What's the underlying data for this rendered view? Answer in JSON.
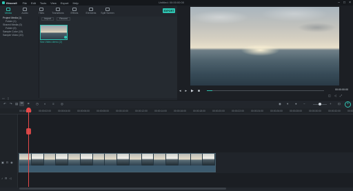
{
  "app": {
    "name": "filmora9",
    "doc_title": "Untitled: 00:00:00:00"
  },
  "menu": [
    "File",
    "Edit",
    "Tools",
    "View",
    "Export",
    "Help"
  ],
  "tabs": [
    {
      "label": "Media",
      "active": true
    },
    {
      "label": "Audio"
    },
    {
      "label": "Titles"
    },
    {
      "label": "Transitions"
    },
    {
      "label": "Effects"
    },
    {
      "label": "Elements"
    },
    {
      "label": "Split Screen"
    }
  ],
  "export_label": "EXPORT",
  "media_tree": [
    {
      "label": "Project Media (1)",
      "selected": true
    },
    {
      "label": "Folder (1)"
    },
    {
      "label": "Shared Media (0)"
    },
    {
      "label": "Folder (0)"
    },
    {
      "label": "Sample Color (15)"
    },
    {
      "label": "Sample Video (20)"
    }
  ],
  "library": {
    "import_label": "Import",
    "record_label": "Record",
    "clip_label": "Sea Video demo (2)"
  },
  "preview": {
    "timecode": "00:00:00:00"
  },
  "timeline": {
    "ruler": [
      "00:00:00:00",
      "00:00:02:00",
      "00:00:04:00",
      "00:00:06:00",
      "00:00:08:00",
      "00:00:10:00",
      "00:00:12:00",
      "00:00:14:00",
      "00:00:16:00",
      "00:00:18:00",
      "00:00:20:00",
      "00:00:22:00",
      "00:00:24:00",
      "00:00:26:00",
      "00:00:28:00",
      "00:00:30:00",
      "00:00:32:00",
      "00:00:34:00"
    ]
  }
}
